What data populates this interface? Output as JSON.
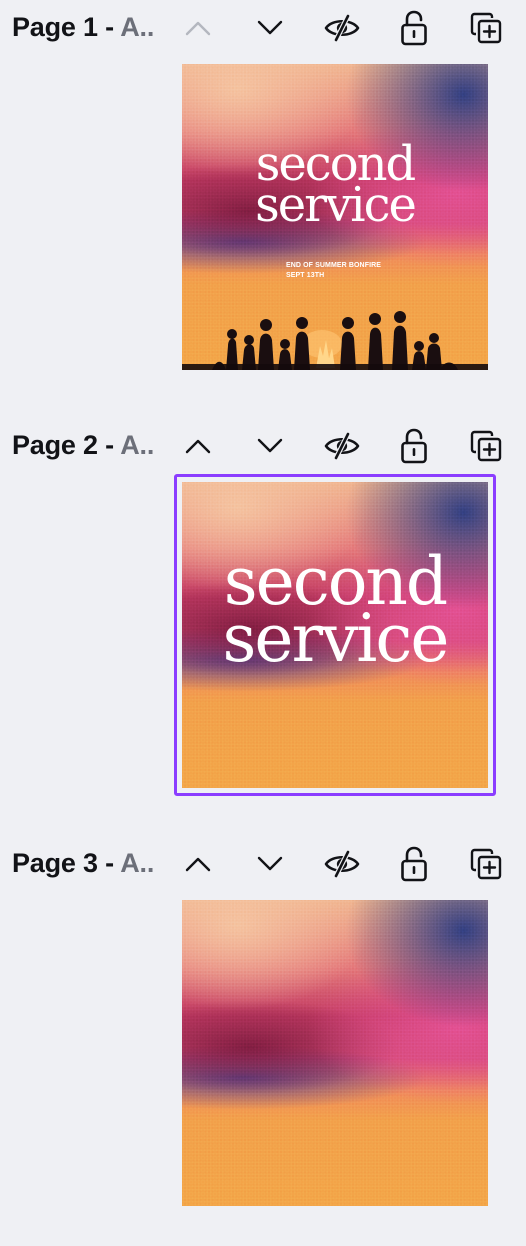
{
  "pages": [
    {
      "title": "Page 1 - ",
      "title_suffix": "A..",
      "selected": false,
      "headline": [
        "second",
        "service"
      ],
      "event_line1": "END OF SUMMER BONFIRE",
      "event_line2": "SEPT 13TH"
    },
    {
      "title": "Page 2 - ",
      "title_suffix": "A..",
      "selected": true,
      "headline": [
        "second",
        "service"
      ]
    },
    {
      "title": "Page 3 - ",
      "title_suffix": "A..",
      "selected": false
    }
  ],
  "controls": {
    "move_up_icon": "chevron-up-icon",
    "move_down_icon": "chevron-down-icon",
    "hide_icon": "eye-slash-icon",
    "lock_icon": "unlock-icon",
    "duplicate_icon": "duplicate-icon"
  },
  "colors": {
    "selection": "#8b3dff",
    "background": "#eff0f4",
    "icon": "#121317",
    "icon_disabled": "#b4b7bf"
  }
}
